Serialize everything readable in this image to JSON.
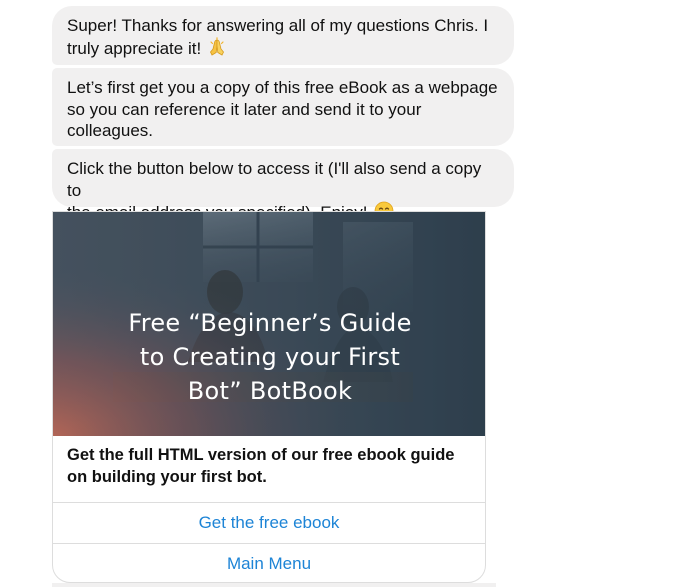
{
  "messages": [
    {
      "line1": "Super!  Thanks for answering all of my questions Chris.  I",
      "line2": "truly appreciate it!",
      "emoji": "praying-hands-icon"
    },
    {
      "line1": "Let’s first get you a copy of this free eBook as a webpage",
      "line2": "so you can reference it later and send it to your",
      "line3": "colleagues."
    },
    {
      "line1": "Click the button below to access it (I'll also send a copy to",
      "line2": "the email address you specified).  Enjoy!",
      "emoji": "grinning-face-icon"
    }
  ],
  "card": {
    "image_title": {
      "line1": "Free “Beginner’s Guide",
      "line2": "to Creating your First",
      "line3": "Bot” BotBook"
    },
    "title_line1": "Get the full HTML version of our free ebook guide",
    "title_line2": "on building your first bot.",
    "buttons": [
      {
        "label": "Get the free ebook"
      },
      {
        "label": "Main Menu"
      }
    ]
  },
  "colors": {
    "bubble": "#f1f0f0",
    "button_text": "#1d84d6",
    "card_border": "#dddddd"
  }
}
